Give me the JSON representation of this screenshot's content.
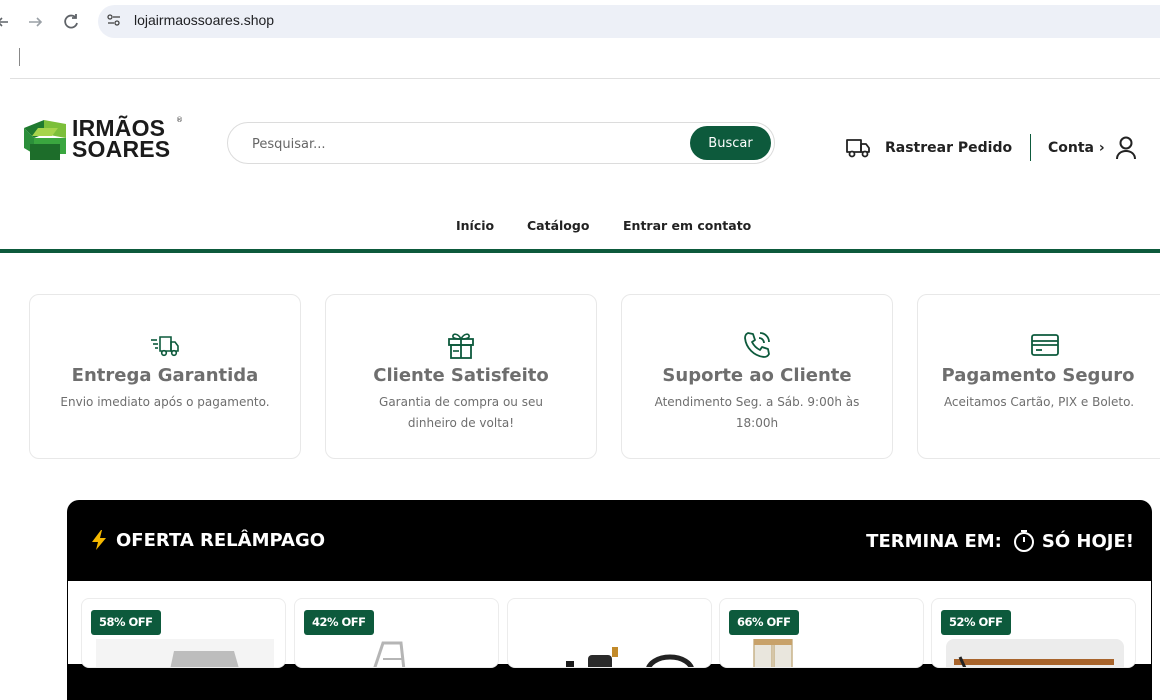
{
  "browser": {
    "url": "lojairmaossoares.shop"
  },
  "header": {
    "logo_line1": "IRMÃOS",
    "logo_line2": "SOARES",
    "logo_reg": "®",
    "search_placeholder": "Pesquisar...",
    "search_button": "Buscar",
    "track_label": "Rastrear Pedido",
    "account_label": "Conta ›"
  },
  "nav": {
    "items": [
      "Início",
      "Catálogo",
      "Entrar em contato"
    ]
  },
  "features": [
    {
      "icon": "delivery-truck-icon",
      "title": "Entrega Garantida",
      "desc": "Envio imediato após o pagamento."
    },
    {
      "icon": "gift-box-icon",
      "title": "Cliente Satisfeito",
      "desc": "Garantia de compra ou seu dinheiro de volta!"
    },
    {
      "icon": "phone-call-icon",
      "title": "Suporte ao Cliente",
      "desc": "Atendimento Seg. a Sáb. 9:00h às 18:00h"
    },
    {
      "icon": "credit-card-icon",
      "title": "Pagamento Seguro",
      "desc": "Aceitamos Cartão, PIX e Boleto."
    }
  ],
  "flash_sale": {
    "title": "OFERTA RELÂMPAGO",
    "ends_label": "TERMINA EM:",
    "ends_value": "SÓ HOJE!",
    "products": [
      {
        "badge": "58% OFF"
      },
      {
        "badge": "42% OFF"
      },
      {
        "badge": ""
      },
      {
        "badge": "66% OFF"
      },
      {
        "badge": "52% OFF"
      }
    ]
  },
  "colors": {
    "brand_green": "#0d5a3c",
    "flash_bg": "#000000"
  }
}
